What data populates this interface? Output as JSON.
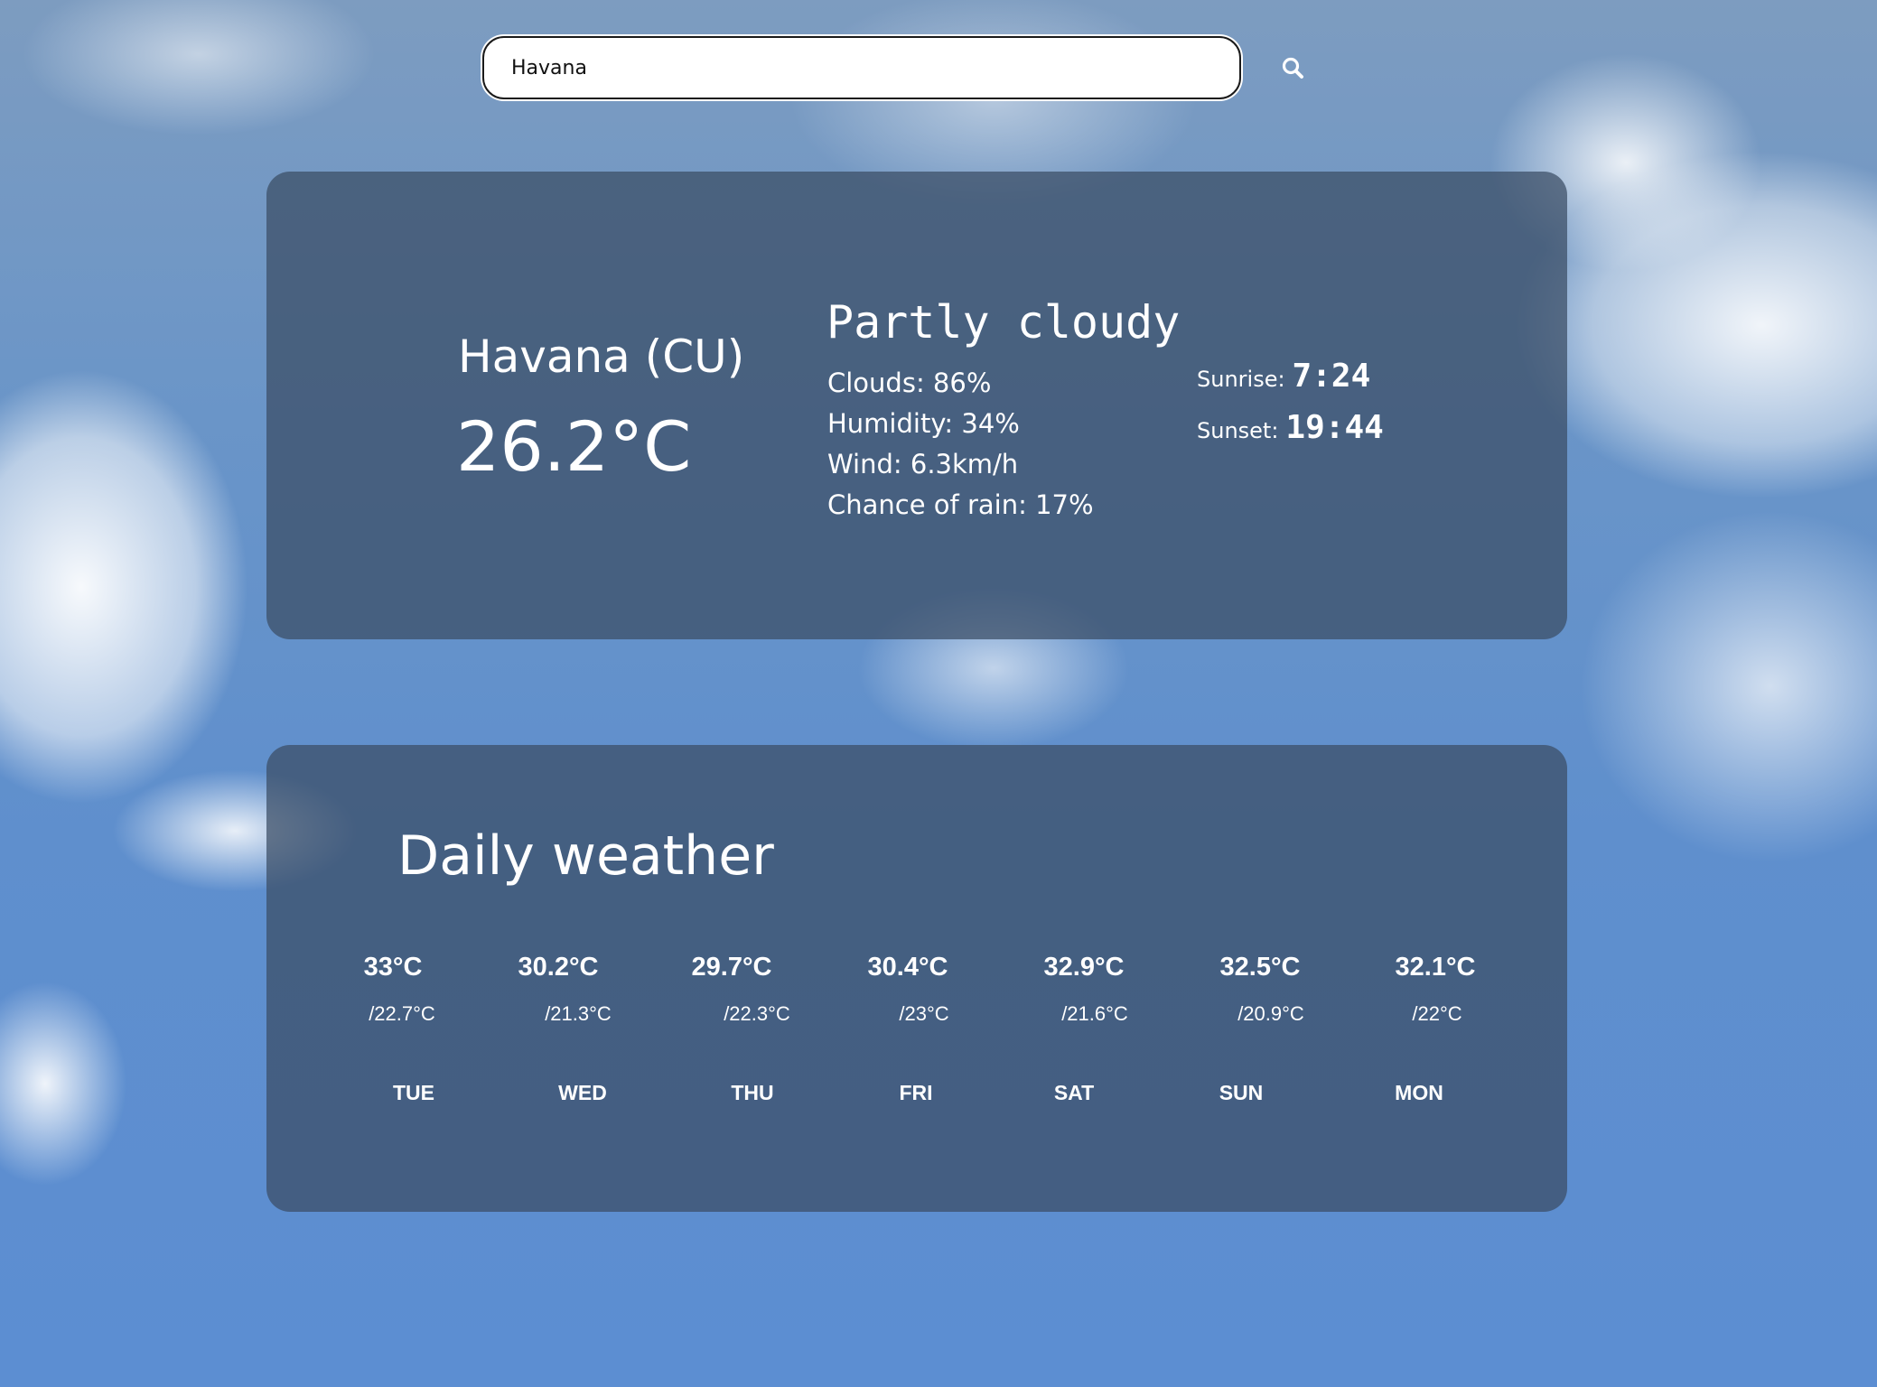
{
  "search": {
    "value": "Havana"
  },
  "current": {
    "city": "Havana (CU)",
    "temperature": "26.2°C",
    "condition": "Partly cloudy",
    "clouds": "Clouds: 86%",
    "humidity": "Humidity: 34%",
    "wind": "Wind: 6.3km/h",
    "rain": "Chance of rain: 17%",
    "sunrise_label": "Sunrise:",
    "sunrise": "7:24",
    "sunset_label": "Sunset:",
    "sunset": "19:44"
  },
  "daily": {
    "title": "Daily weather",
    "days": [
      {
        "high": "33°C",
        "low": "/22.7°C",
        "name": "TUE"
      },
      {
        "high": "30.2°C",
        "low": "/21.3°C",
        "name": "WED"
      },
      {
        "high": "29.7°C",
        "low": "/22.3°C",
        "name": "THU"
      },
      {
        "high": "30.4°C",
        "low": "/23°C",
        "name": "FRI"
      },
      {
        "high": "32.9°C",
        "low": "/21.6°C",
        "name": "SAT"
      },
      {
        "high": "32.5°C",
        "low": "/20.9°C",
        "name": "SUN"
      },
      {
        "high": "32.1°C",
        "low": "/22°C",
        "name": "MON"
      }
    ]
  }
}
